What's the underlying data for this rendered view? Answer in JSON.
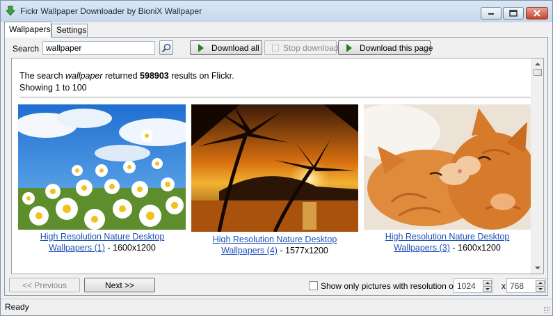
{
  "window": {
    "title": "Fickr Wallpaper Downloader by BioniX Wallpaper",
    "controls": [
      "minimize",
      "maximize",
      "close"
    ]
  },
  "tabs": [
    {
      "label": "Wallpapers",
      "active": true
    },
    {
      "label": "Settings",
      "active": false
    }
  ],
  "toolbar": {
    "search_label": "Search",
    "search_value": "wallpaper",
    "search_icon": "magnifier-icon",
    "download_all_label": "Download all",
    "stop_download_label": "Stop download",
    "download_page_label": "Download this page"
  },
  "results": {
    "prefix": "The search ",
    "query": "wallpaper",
    "middle": " returned ",
    "count": "598903",
    "suffix": " results on Flickr.",
    "showing": "Showing 1 to 100"
  },
  "items": [
    {
      "title_line1": "High Resolution Nature Desktop",
      "title_line2": "Wallpapers (1)",
      "resolution": " - 1600x1200",
      "image": "daisies-under-blue-sky"
    },
    {
      "title_line1": "High Resolution Nature Desktop",
      "title_line2": "Wallpapers (4)",
      "resolution": " - 1577x1200",
      "image": "palm-trees-sunset"
    },
    {
      "title_line1": "High Resolution Nature Desktop",
      "title_line2": "Wallpapers (3)",
      "resolution": " - 1600x1200",
      "image": "sleeping-kittens"
    }
  ],
  "footer": {
    "previous_label": "<< Previous",
    "next_label": "Next >>",
    "filter_label": "Show only pictures with resolution over:",
    "filter_checked": false,
    "width_value": "1024",
    "times": "x",
    "height_value": "768"
  },
  "status": {
    "text": "Ready"
  },
  "colors": {
    "link": "#1c4fb5",
    "accent_green": "#2a7a2a",
    "close_red": "#c8422a"
  }
}
